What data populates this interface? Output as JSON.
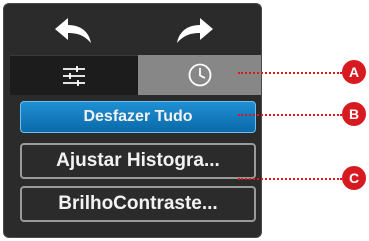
{
  "toolbar": {
    "undo_icon": "undo-arrow-icon",
    "redo_icon": "redo-arrow-icon"
  },
  "tabs": [
    {
      "icon": "sliders-icon",
      "active": false
    },
    {
      "icon": "clock-history-icon",
      "active": true
    }
  ],
  "history": {
    "undo_all_label": "Desfazer Tudo",
    "items": [
      {
        "label": "Ajustar Histogra..."
      },
      {
        "label": "BrilhoContraste..."
      }
    ]
  },
  "callouts": [
    {
      "label": "A"
    },
    {
      "label": "B"
    },
    {
      "label": "C"
    }
  ],
  "colors": {
    "panel_bg": "#2b2b2b",
    "accent_blue": "#0f7cc0",
    "active_tab": "#878787",
    "callout_red": "#d71920"
  }
}
